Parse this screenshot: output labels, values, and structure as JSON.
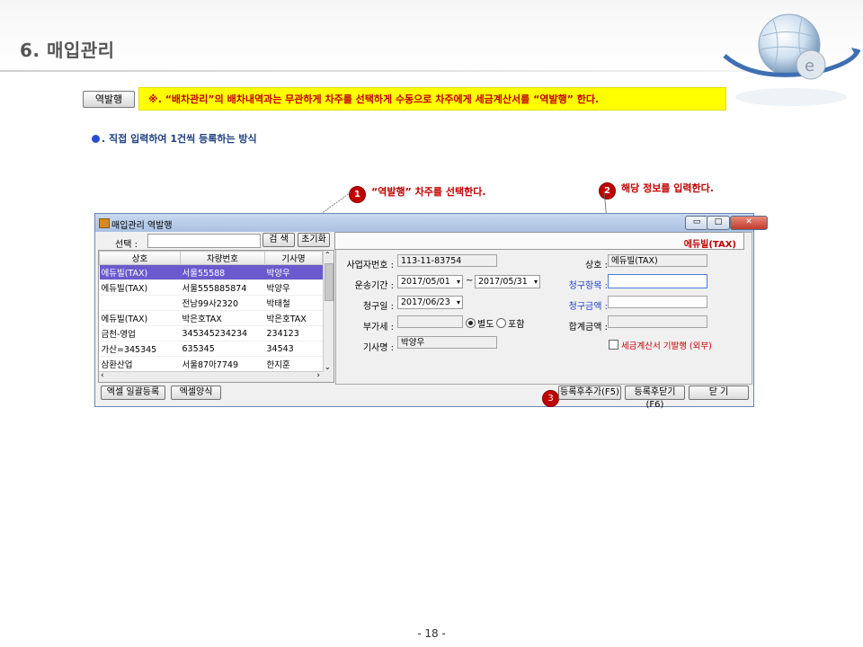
{
  "header": {
    "title": "6. 매입관리"
  },
  "top_note": {
    "tag_label": "역발행",
    "text": "※. “배차관리”의  배차내역과는 무관하게 차주를 선택하게 수동으로 차주에게 세금계산서를 “역발행” 한다."
  },
  "bullet_text": ". 직접 입력하여 1건씩 등록하는 방식",
  "callouts": [
    {
      "num": "1",
      "text": "“역발행” 차주를 선택한다."
    },
    {
      "num": "2",
      "text": "해당 정보를 입력한다."
    },
    {
      "num": "3",
      "text": ""
    }
  ],
  "window": {
    "title": "매입관리 역발행",
    "controls": {
      "min": "▭",
      "max": "□",
      "close": "✕"
    },
    "search_label": "선택 :",
    "search_value": "",
    "search_button": "검 색",
    "reset_button": "초기화",
    "grid": {
      "columns": [
        "상호",
        "차량번호",
        "기사명"
      ],
      "rows": [
        [
          "에듀빌(TAX)",
          "서울55588",
          "박양우"
        ],
        [
          "에듀빌(TAX)",
          "서울555885874",
          "박양우"
        ],
        [
          "",
          "전남99사2320",
          "박태철"
        ],
        [
          "에듀빌(TAX)",
          "박은호TAX",
          "박은호TAX"
        ],
        [
          "금천-영업",
          "345345234234",
          "234123"
        ],
        [
          "가산=345345",
          "635345",
          "34543"
        ],
        [
          "삼환산업",
          "서울87아7749",
          "한지훈"
        ]
      ],
      "selected_row": 0
    },
    "panel_header": "에듀빌(TAX)",
    "form": {
      "bizno_label": "사업자번호 :",
      "bizno_value": "113-11-83754",
      "company_label": "상호 :",
      "company_value": "에듀빌(TAX)",
      "period_label": "운송기간 :",
      "period_from": "2017/05/01",
      "period_sep": "~",
      "period_to": "2017/05/31",
      "item_label": "청구항목 :",
      "item_value": "",
      "claimdate_label": "청구일 :",
      "claimdate_value": "2017/06/23",
      "amount_label": "청구금액 :",
      "amount_value": "",
      "vat_label": "부가세 :",
      "vat_value": "",
      "vat_option1": "별도",
      "vat_option2": "포함",
      "total_label": "합계금액 :",
      "total_value": "",
      "driver_label": "기사명 :",
      "driver_value": "박양우",
      "external_check_label": "세금계산서 기발행 (외부)"
    },
    "buttons": {
      "excel_bulk": "엑셀 일괄등록",
      "excel_form": "엑셀양식",
      "save_add": "등록후추가(F5)",
      "save_close": "등록후닫기(F6)",
      "close": "닫 기"
    }
  },
  "footer": {
    "page": "- 18 -"
  },
  "colors": {
    "accent_red": "#c00000",
    "note_yellow": "#ffff00",
    "select_purple": "#6a5acd",
    "link_blue": "#1e3ec8"
  }
}
